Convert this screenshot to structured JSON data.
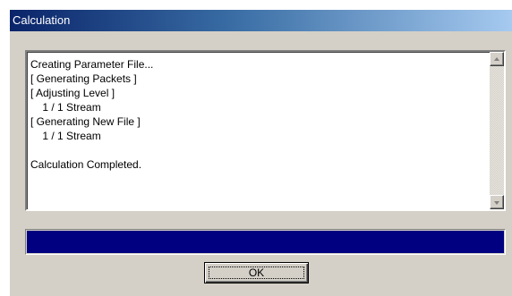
{
  "window": {
    "title": "Calculation"
  },
  "log": {
    "lines": [
      "Creating Parameter File...",
      "[ Generating Packets ]",
      "[ Adjusting Level ]",
      "    1 / 1 Stream",
      "[ Generating New File ]",
      "    1 / 1 Stream",
      "",
      "Calculation Completed."
    ]
  },
  "progress": {
    "fraction": 1.0,
    "color": "#000080"
  },
  "buttons": {
    "ok_label": "OK"
  },
  "icons": {
    "scroll_up": "scroll-up-arrow",
    "scroll_down": "scroll-down-arrow"
  }
}
